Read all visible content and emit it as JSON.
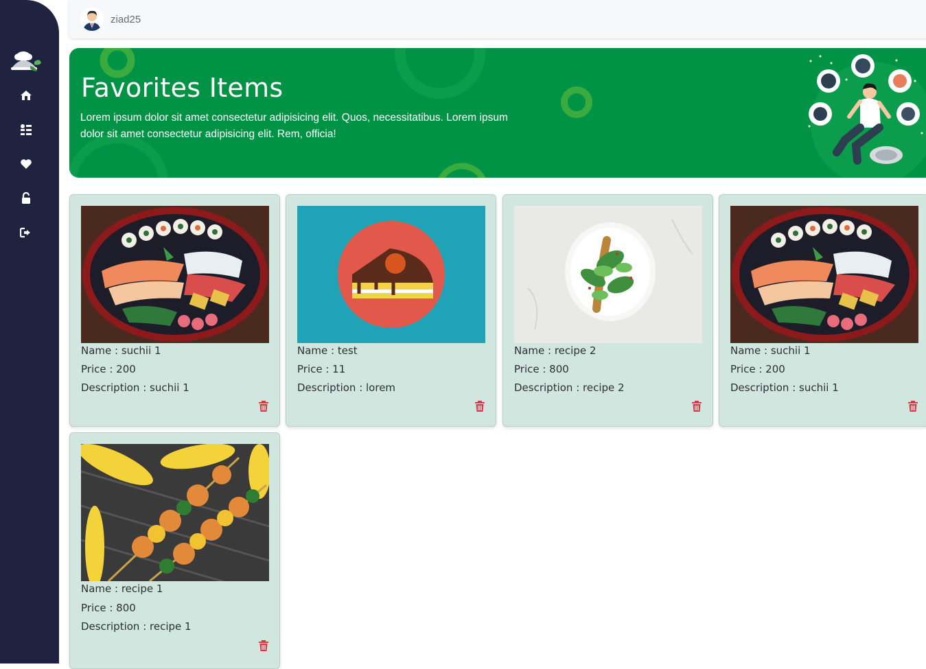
{
  "topbar": {
    "username": "ziad25"
  },
  "sidebar": {
    "items": [
      {
        "icon": "home-icon"
      },
      {
        "icon": "recipes-list-icon"
      },
      {
        "icon": "heart-icon"
      },
      {
        "icon": "unlock-icon"
      },
      {
        "icon": "logout-icon"
      }
    ]
  },
  "hero": {
    "title": "Favorites Items",
    "text": "Lorem ipsum dolor sit amet consectetur adipisicing elit. Quos, necessitatibus. Lorem ipsum dolor sit amet consectetur adipisicing elit. Rem, officia!"
  },
  "cards": [
    {
      "name": "Name : suchii 1",
      "price": "Price : 200",
      "description": "Description : suchii 1",
      "image": "sushi"
    },
    {
      "name": "Name : test",
      "price": "Price : 11",
      "description": "Description : lorem",
      "image": "cake"
    },
    {
      "name": "Name : recipe 2",
      "price": "Price : 800",
      "description": "Description : recipe 2",
      "image": "salad"
    },
    {
      "name": "Name : suchii 1",
      "price": "Price : 200",
      "description": "Description : suchii 1",
      "image": "sushi"
    },
    {
      "name": "Name : recipe 1",
      "price": "Price : 800",
      "description": "Description : recipe 1",
      "image": "skewers"
    }
  ],
  "colors": {
    "sidebar": "#1f2340",
    "hero": "#009245",
    "card": "#d1e6de",
    "delete": "#dc3545"
  }
}
